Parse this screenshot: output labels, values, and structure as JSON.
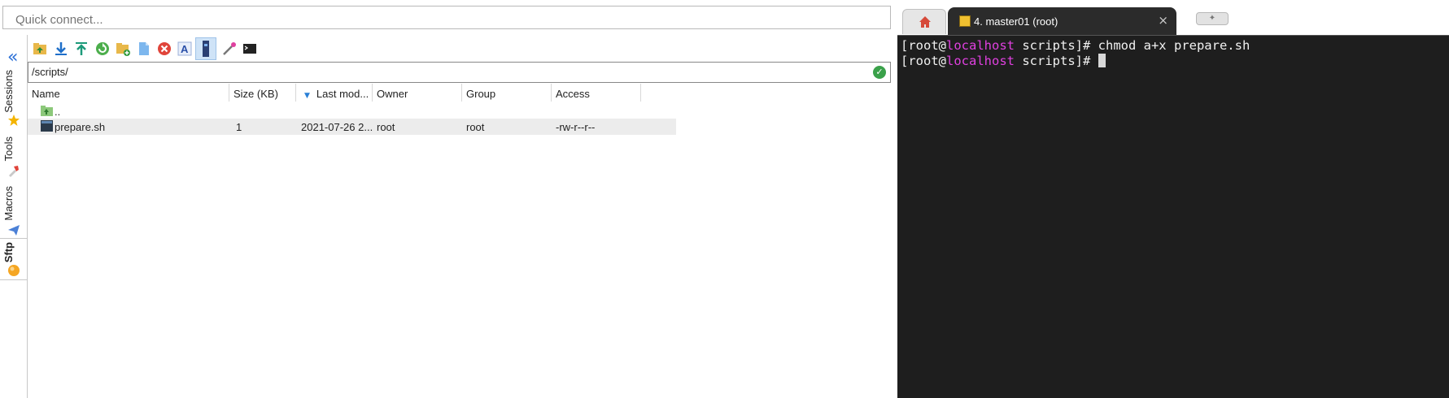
{
  "quick_connect": {
    "placeholder": "Quick connect..."
  },
  "sidebar": {
    "collapse_icon": "chevrons-left-icon",
    "tabs": [
      {
        "label": "Sessions",
        "icon": "star-icon"
      },
      {
        "label": "Tools",
        "icon": "tools-icon"
      },
      {
        "label": "Macros",
        "icon": "paper-plane-icon"
      },
      {
        "label": "Sftp",
        "icon": "sftp-orb-icon",
        "active": true
      }
    ]
  },
  "sftp": {
    "toolbar": [
      "parent-folder-icon",
      "download-icon",
      "upload-icon",
      "refresh-icon",
      "new-folder-icon",
      "new-file-icon",
      "delete-icon",
      "rename-icon",
      "follow-terminal-icon",
      "wand-icon",
      "terminal-icon"
    ],
    "path": "/scripts/",
    "columns": [
      "Name",
      "Size (KB)",
      "Last mod...",
      "Owner",
      "Group",
      "Access"
    ],
    "rows": [
      {
        "name": "..",
        "size": "",
        "modified": "",
        "owner": "",
        "group": "",
        "access": ""
      },
      {
        "name": "prepare.sh",
        "size": "1",
        "modified": "2021-07-26 2...",
        "owner": "root",
        "group": "root",
        "access": "-rw-r--r--"
      }
    ]
  },
  "terminal": {
    "tab_title": "4. master01 (root)",
    "lines": [
      {
        "prefix": "[root@",
        "host": "localhost",
        "suffix": " scripts]# chmod a+x prepare.sh"
      },
      {
        "prefix": "[root@",
        "host": "localhost",
        "suffix": " scripts]# "
      }
    ]
  },
  "colors": {
    "terminal_bg": "#1e1e1e",
    "host": "#e040e0",
    "accent": "#2a6fd6"
  }
}
